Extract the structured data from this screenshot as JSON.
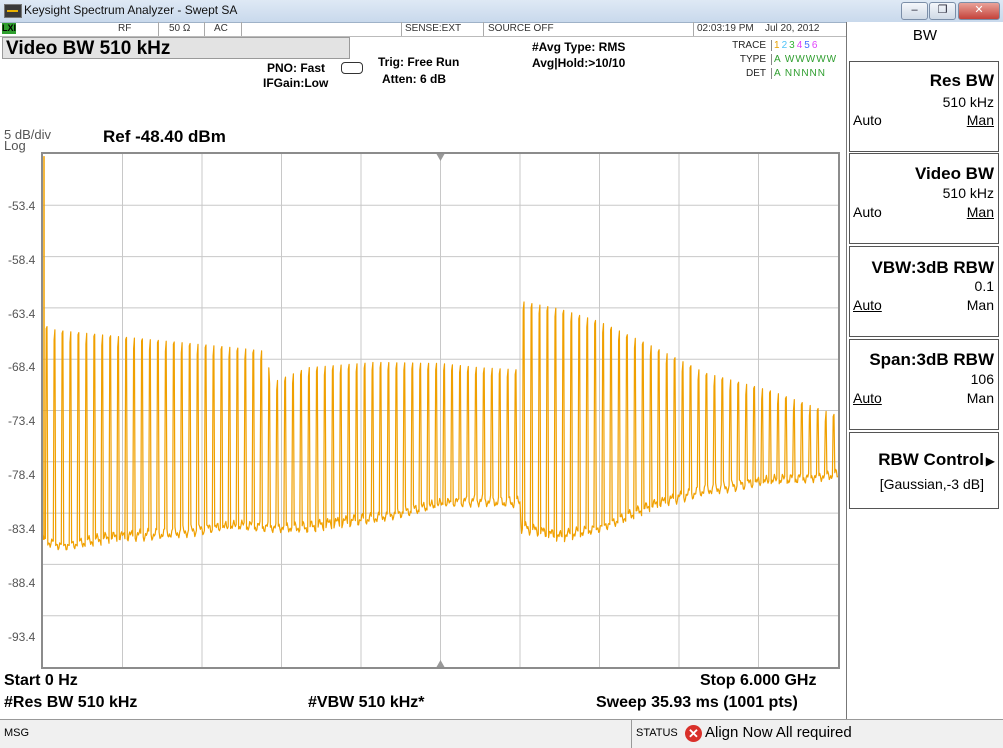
{
  "window": {
    "title": "Keysight Spectrum Analyzer - Swept SA",
    "minimize_icon": "minimize-icon",
    "maximize_icon": "restore-icon",
    "close_icon": "close-icon"
  },
  "status_row": {
    "lxi": "LXI",
    "rf": "RF",
    "impedance": "50 Ω",
    "coupling": "AC",
    "sense": "SENSE:EXT",
    "source": "SOURCE OFF",
    "time": "02:03:19 PM",
    "date": "Jul 20, 2012"
  },
  "measurement": {
    "title": "Video BW 510 kHz",
    "pno": "PNO: Fast",
    "ifgain": "IFGain:Low",
    "trig": "Trig: Free Run",
    "atten": "Atten: 6 dB",
    "avg_type": "#Avg Type: RMS",
    "avg_hold": "Avg|Hold:>10/10"
  },
  "trace_table": {
    "trace_label": "TRACE",
    "type_label": "TYPE",
    "det_label": "DET",
    "trace_values": [
      "1",
      "2",
      "3",
      "4",
      "5",
      "6"
    ],
    "trace_colors": [
      "#e8a000",
      "#4fc3f7",
      "#33b533",
      "#e040fb",
      "#3f6fff",
      "#e040fb"
    ],
    "type_value": "A WWWWW",
    "det_value": "A NNNNN"
  },
  "display": {
    "scale": "5 dB/div",
    "mode": "Log",
    "ref_level": "Ref -48.40 dBm"
  },
  "chart_data": {
    "type": "line",
    "xlabel": "",
    "ylabel": "",
    "xlim": [
      0,
      6.0
    ],
    "ylim": [
      -96.4,
      -48.4
    ],
    "yticks": [
      "-53.4",
      "-58.4",
      "-63.4",
      "-68.4",
      "-73.4",
      "-78.4",
      "-83.4",
      "-88.4",
      "-93.4"
    ],
    "trace_color": "#f0a000",
    "grid": true,
    "series": [
      {
        "floor_x": [
          0.0,
          0.15,
          0.5,
          1.0,
          1.5,
          2.0,
          2.5,
          3.0,
          3.3,
          3.6,
          3.61,
          3.9,
          4.2,
          4.6,
          5.0,
          5.5,
          6.0
        ],
        "floor_y": [
          -84.5,
          -85.0,
          -84.3,
          -83.8,
          -83.2,
          -83.3,
          -82.4,
          -81.2,
          -80.8,
          -81.0,
          -83.3,
          -84.2,
          -83.3,
          -81.3,
          -79.8,
          -79.0,
          -78.3
        ],
        "peak_x": [
          0.0,
          0.1,
          0.5,
          1.0,
          1.5,
          1.7,
          1.71,
          2.0,
          2.5,
          3.0,
          3.3,
          3.6,
          3.61,
          3.9,
          4.2,
          4.6,
          5.0,
          5.5,
          6.0
        ],
        "peak_y": [
          -65.0,
          -65.5,
          -66.0,
          -66.6,
          -67.2,
          -67.5,
          -70.5,
          -69.0,
          -68.5,
          -68.6,
          -69.0,
          -69.2,
          -62.8,
          -63.5,
          -64.7,
          -67.0,
          -69.5,
          -71.2,
          -73.5
        ],
        "spike_spacing_ghz": 0.06
      }
    ]
  },
  "footer": {
    "start": "Start 0 Hz",
    "stop": "Stop 6.000 GHz",
    "res_bw": "#Res BW 510 kHz",
    "vbw": "#VBW 510 kHz*",
    "sweep": "Sweep  35.93 ms (1001 pts)"
  },
  "softkeys": {
    "menu_title": "BW",
    "res_bw": {
      "title": "Res BW",
      "value": "510 kHz",
      "auto": "Auto",
      "man": "Man"
    },
    "video_bw": {
      "title": "Video BW",
      "value": "510 kHz",
      "auto": "Auto",
      "man": "Man"
    },
    "vbw_rbw": {
      "title": "VBW:3dB RBW",
      "value": "0.1",
      "auto": "Auto",
      "man": "Man"
    },
    "span_rbw": {
      "title": "Span:3dB RBW",
      "value": "106",
      "auto": "Auto",
      "man": "Man"
    },
    "rbw_control": {
      "title": "RBW Control",
      "value": "[Gaussian,-3 dB]"
    }
  },
  "message_bar": {
    "msg_label": "MSG",
    "status_label": "STATUS",
    "status_text": "Align Now All required",
    "status_icon": "error-icon"
  }
}
